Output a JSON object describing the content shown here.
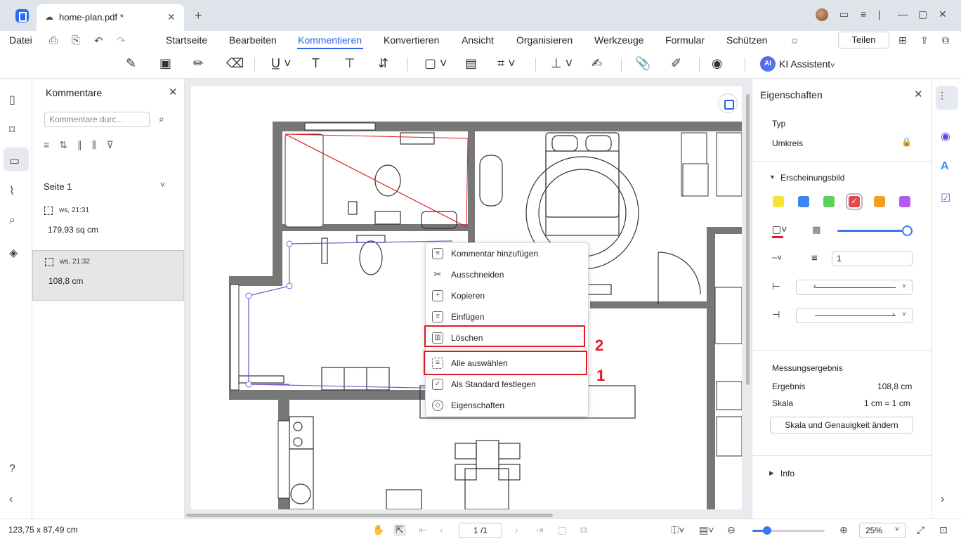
{
  "titlebar": {
    "tab_title": "home-plan.pdf *",
    "close": "✕",
    "new_tab": "+"
  },
  "menubar": {
    "file": "Datei",
    "items": [
      "Startseite",
      "Bearbeiten",
      "Kommentieren",
      "Konvertieren",
      "Ansicht",
      "Organisieren",
      "Werkzeuge",
      "Formular",
      "Schützen"
    ],
    "active": "Kommentieren",
    "share_label": "Teilen"
  },
  "toolbar": {
    "ai_badge": "AI",
    "ai_label": "KI Assistent"
  },
  "comments_panel": {
    "title": "Kommentare",
    "search_placeholder": "Kommentare durc...",
    "page_label": "Seite 1",
    "items": [
      {
        "author": "ws,",
        "time": "21:31",
        "text": "179,93 sq cm",
        "selected": false
      },
      {
        "author": "ws,",
        "time": "21:32",
        "text": "108,8 cm",
        "selected": true
      }
    ]
  },
  "context_menu": {
    "items": [
      "Kommentar hinzufügen",
      "Ausschneiden",
      "Kopieren",
      "Einfügen",
      "Löschen",
      "Alle auswählen",
      "Als Standard festlegen",
      "Eigenschaften"
    ],
    "highlight_numbers": [
      "2",
      "1"
    ]
  },
  "properties": {
    "title": "Eigenschaften",
    "type_label": "Typ",
    "type_value": "Umkreis",
    "appearance_label": "Erscheinungsbild",
    "colors": [
      "#f5e33a",
      "#3d86f0",
      "#5bd15b",
      "#e8474f",
      "#f59d1f",
      "#b659f2"
    ],
    "selected_color": "#e8474f",
    "line_width": "1",
    "measurement_label": "Messungsergebnis",
    "result_label": "Ergebnis",
    "result_value": "108,8 cm",
    "scale_label": "Skala",
    "scale_value": "1 cm = 1 cm",
    "scale_button": "Skala und Genauigkeit ändern",
    "info_label": "Info"
  },
  "statusbar": {
    "coords": "123,75 x 87,49 cm",
    "page": "1 /1",
    "zoom": "25%",
    "zoom_level": 0.2
  }
}
